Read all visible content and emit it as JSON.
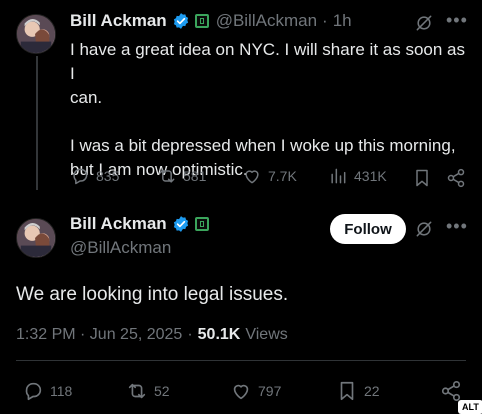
{
  "reply": {
    "author_name": "Bill Ackman",
    "handle": "@BillAckman",
    "separator": "·",
    "time_ago": "1h",
    "text_line1": "I have a great idea on NYC. I will share it as soon as I",
    "text_line2": "can.",
    "text_line3": "I was a bit depressed when I woke up this morning,",
    "text_line4": "but I am now optimistic.",
    "stats": {
      "replies": "835",
      "reposts": "581",
      "likes": "7.7K",
      "views": "431K"
    }
  },
  "main": {
    "author_name": "Bill Ackman",
    "handle": "@BillAckman",
    "follow_label": "Follow",
    "text": "We are looking into legal issues.",
    "timestamp": "1:32 PM · Jun 25, 2025",
    "dot": "·",
    "views_count": "50.1K",
    "views_label": "Views",
    "stats": {
      "replies": "118",
      "reposts": "52",
      "likes": "797",
      "bookmarks": "22"
    }
  },
  "alt_badge": "ALT",
  "colors": {
    "accent": "#1d9bf0",
    "gov_badge": "#3ba55c",
    "muted": "#71767b"
  }
}
